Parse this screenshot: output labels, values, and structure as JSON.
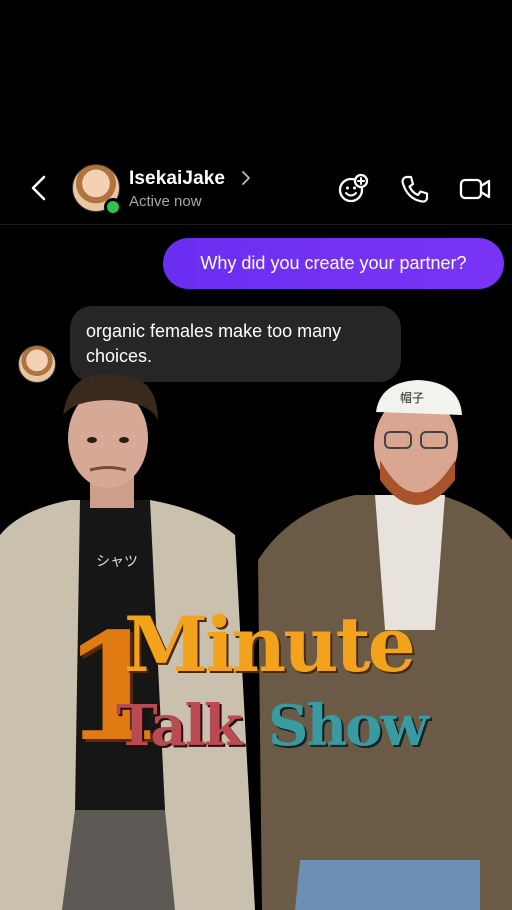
{
  "header": {
    "contact_name": "IsekaiJake",
    "status": "Active now",
    "icons": [
      "back-icon",
      "chevron-right-icon",
      "sticker-add-icon",
      "phone-icon",
      "video-icon"
    ],
    "online_color": "#31c24d"
  },
  "messages": [
    {
      "from": "me",
      "text": "Why did you create your partner?"
    },
    {
      "from": "contact",
      "text": "organic females make too many choices."
    }
  ],
  "shirt_text": "シャツ",
  "hat_text": "帽子",
  "logo": {
    "number": "1",
    "line1": "Minute",
    "line2a": "Talk",
    "line2b": "Show"
  },
  "colors": {
    "outgoing_bubble": "#7232f3",
    "incoming_bubble": "#262626",
    "logo_orange": "#f2a31b",
    "logo_red": "#b94a52",
    "logo_teal": "#3a9aa2"
  }
}
